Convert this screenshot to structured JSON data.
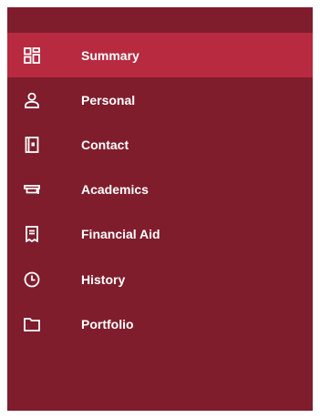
{
  "colors": {
    "sidebar_bg": "#7f1d2d",
    "active_bg": "#b72a3f",
    "text": "#ffffff"
  },
  "sidebar": {
    "items": [
      {
        "label": "Summary",
        "icon": "dashboard-grid-icon",
        "active": true
      },
      {
        "label": "Personal",
        "icon": "person-icon",
        "active": false
      },
      {
        "label": "Contact",
        "icon": "contact-book-icon",
        "active": false
      },
      {
        "label": "Academics",
        "icon": "graduation-cap-icon",
        "active": false
      },
      {
        "label": "Financial Aid",
        "icon": "receipt-icon",
        "active": false
      },
      {
        "label": "History",
        "icon": "clock-icon",
        "active": false
      },
      {
        "label": "Portfolio",
        "icon": "folder-icon",
        "active": false
      }
    ]
  }
}
